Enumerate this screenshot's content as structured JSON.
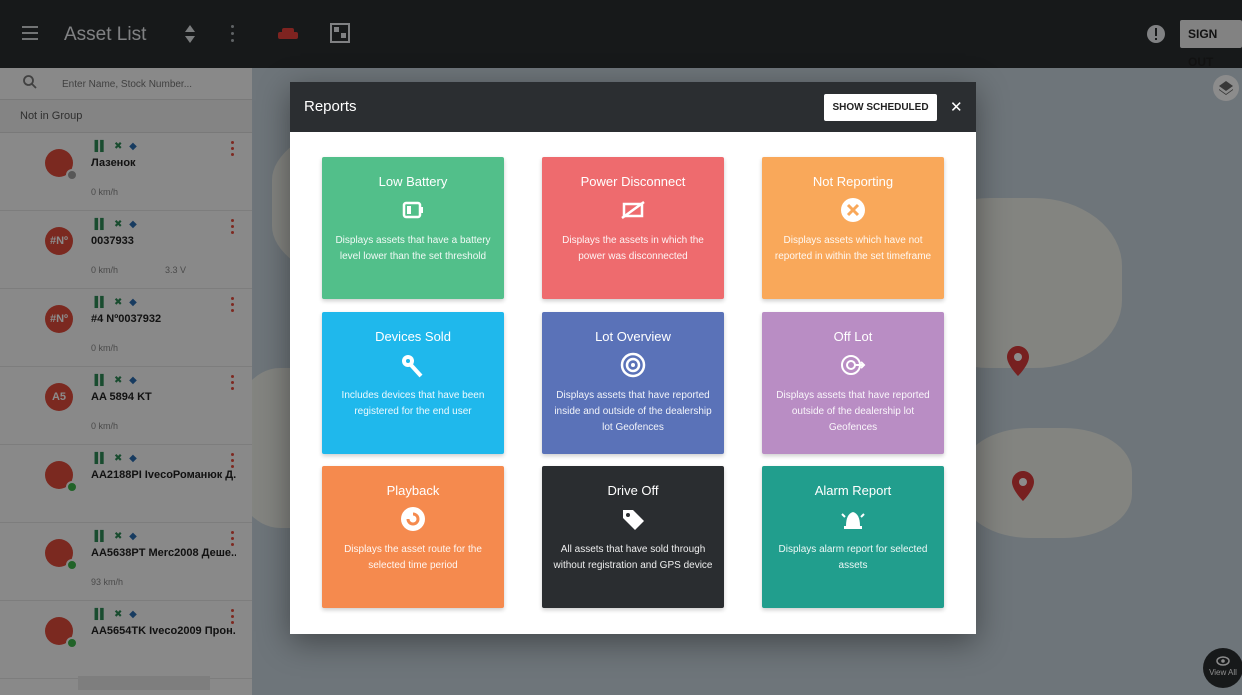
{
  "topbar": {
    "title": "Asset List",
    "sign_out": "SIGN OUT"
  },
  "sidebar": {
    "search_placeholder": "Enter Name, Stock Number...",
    "group": "Not in Group",
    "assets": [
      {
        "avatar": "",
        "avatar_color": "#e14b3b",
        "dot_color": "#9e9e9e",
        "name": "Лазенок",
        "speed": "0 km/h",
        "voltage": ""
      },
      {
        "avatar": "#Nº",
        "avatar_color": "#e14b3b",
        "dot_color": "",
        "name": "0037933",
        "speed": "0 km/h",
        "voltage": "3.3 V"
      },
      {
        "avatar": "#Nº",
        "avatar_color": "#e14b3b",
        "dot_color": "",
        "name": "#4 Nº0037932",
        "speed": "0 km/h",
        "voltage": ""
      },
      {
        "avatar": "A5",
        "avatar_color": "#e14b3b",
        "dot_color": "",
        "name": "AA 5894 KT",
        "speed": "0 km/h",
        "voltage": ""
      },
      {
        "avatar": "",
        "avatar_color": "#e14b3b",
        "dot_color": "#3cb54a",
        "name": "AA2188PI IvecoРоманюк Д...",
        "speed": "",
        "voltage": ""
      },
      {
        "avatar": "",
        "avatar_color": "#e14b3b",
        "dot_color": "#3cb54a",
        "name": "AA5638PT Merc2008 Деше...",
        "speed": "93 km/h",
        "voltage": ""
      },
      {
        "avatar": "",
        "avatar_color": "#e14b3b",
        "dot_color": "#3cb54a",
        "name": "AA5654TK Iveco2009 Прон...",
        "speed": "",
        "voltage": ""
      }
    ]
  },
  "map": {
    "view_all": "View All"
  },
  "modal": {
    "title": "Reports",
    "show_scheduled": "SHOW SCHEDULED",
    "close": "✕",
    "cards": [
      {
        "title": "Low Battery",
        "icon": "battery-low-icon",
        "color": "#52bf8a",
        "desc": "Displays assets that have a battery level lower than the set threshold"
      },
      {
        "title": "Power Disconnect",
        "icon": "power-disconnect-icon",
        "color": "#ee6b6e",
        "desc": "Displays the assets in which the power was disconnected"
      },
      {
        "title": "Not Reporting",
        "icon": "x-circle-icon",
        "color": "#f9a85a",
        "desc": "Displays assets which have not reported in within the set timeframe"
      },
      {
        "title": "Devices Sold",
        "icon": "key-icon",
        "color": "#1fb8ec",
        "desc": "Includes devices that have been registered for the end user"
      },
      {
        "title": "Lot Overview",
        "icon": "target-icon",
        "color": "#5a72b8",
        "desc": "Displays assets that have reported inside and outside of the dealership lot Geofences"
      },
      {
        "title": "Off Lot",
        "icon": "target-exit-icon",
        "color": "#b98dc4",
        "desc": "Displays assets that have reported outside of the dealership lot Geofences"
      },
      {
        "title": "Playback",
        "icon": "playback-icon",
        "color": "#f58a4e",
        "desc": "Displays the asset route for the selected time period"
      },
      {
        "title": "Drive Off",
        "icon": "tag-icon",
        "color": "#2a2d30",
        "desc": "All assets that have sold through without registration and GPS device"
      },
      {
        "title": "Alarm Report",
        "icon": "alarm-bell-icon",
        "color": "#219e8d",
        "desc": "Displays alarm report for selected assets"
      }
    ]
  }
}
